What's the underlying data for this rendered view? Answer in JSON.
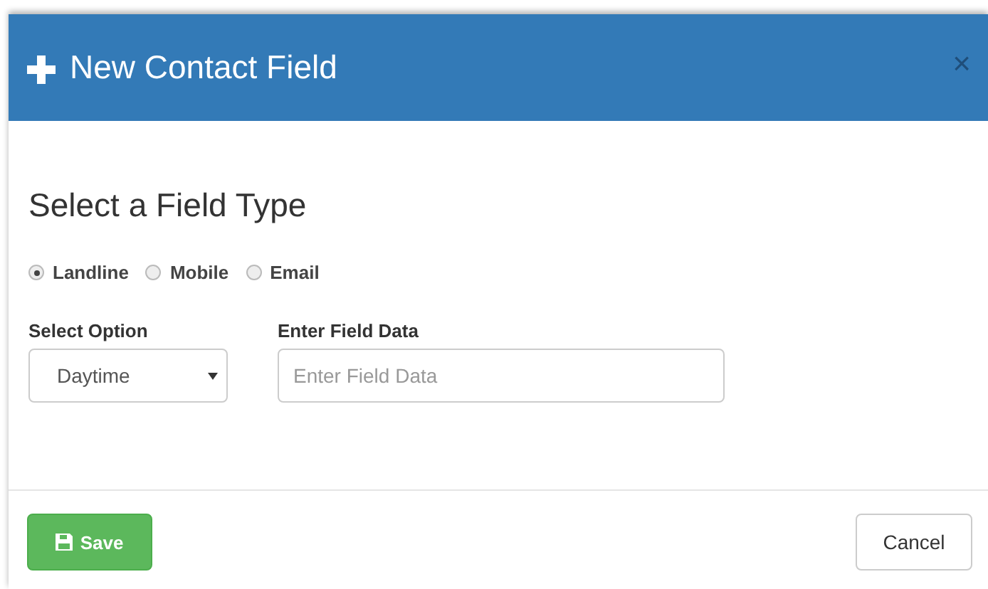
{
  "dialog": {
    "title": "New Contact Field",
    "close": "×"
  },
  "heading": "Select a Field Type",
  "field_types": [
    {
      "label": "Landline",
      "selected": true
    },
    {
      "label": "Mobile",
      "selected": false
    },
    {
      "label": "Email",
      "selected": false
    }
  ],
  "select_option": {
    "label": "Select Option",
    "value": "Daytime"
  },
  "field_data": {
    "label": "Enter Field Data",
    "placeholder": "Enter Field Data"
  },
  "buttons": {
    "save": "Save",
    "cancel": "Cancel"
  }
}
